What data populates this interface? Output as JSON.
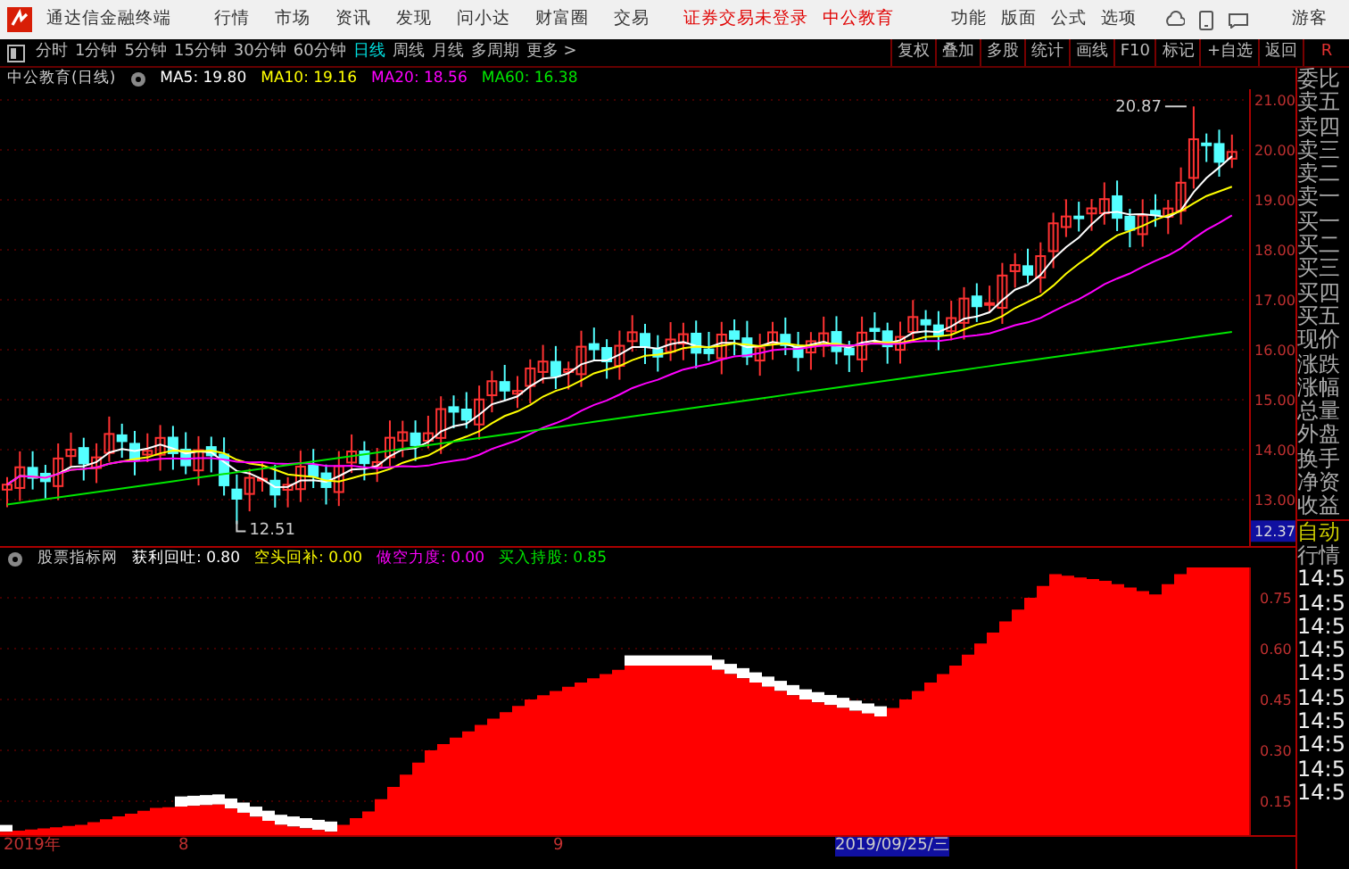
{
  "app": {
    "title": "通达信金融终端",
    "menu": [
      "行情",
      "市场",
      "资讯",
      "发现",
      "问小达",
      "财富圈",
      "交易"
    ],
    "notices": [
      "证券交易未登录",
      "中公教育"
    ],
    "tools": [
      "功能",
      "版面",
      "公式",
      "选项"
    ],
    "user": "游客"
  },
  "periods": [
    {
      "label": "分时",
      "selected": false
    },
    {
      "label": "1分钟",
      "selected": false
    },
    {
      "label": "5分钟",
      "selected": false
    },
    {
      "label": "15分钟",
      "selected": false
    },
    {
      "label": "30分钟",
      "selected": false
    },
    {
      "label": "60分钟",
      "selected": false
    },
    {
      "label": "日线",
      "selected": true
    },
    {
      "label": "周线",
      "selected": false
    },
    {
      "label": "月线",
      "selected": false
    },
    {
      "label": "多周期",
      "selected": false
    },
    {
      "label": "更多 >",
      "selected": false
    }
  ],
  "chart_tools": [
    "复权",
    "叠加",
    "多股",
    "统计",
    "画线",
    "F10",
    "标记",
    "+自选",
    "返回"
  ],
  "corner_label": "R",
  "main_chart": {
    "title": "中公教育(日线)",
    "averages": [
      {
        "label": "MA5: 19.80",
        "color": "#ffffff"
      },
      {
        "label": "MA10: 19.16",
        "color": "#ffff00"
      },
      {
        "label": "MA20: 18.56",
        "color": "#ff00ff"
      },
      {
        "label": "MA60: 16.38",
        "color": "#00e600"
      }
    ],
    "price_axis": [
      "21.00",
      "20.00",
      "19.00",
      "18.00",
      "17.00",
      "16.00",
      "15.00",
      "14.00",
      "13.00"
    ],
    "high_label": "20.87",
    "low_label": "12.51",
    "cursor_price": "12.37"
  },
  "indicator": {
    "title": "股票指标网",
    "values": [
      {
        "label": "获利回吐: 0.80",
        "color": "#ffffff"
      },
      {
        "label": "空头回补: 0.00",
        "color": "#ffff00"
      },
      {
        "label": "做空力度: 0.00",
        "color": "#ff00ff"
      },
      {
        "label": "买入持股: 0.85",
        "color": "#00e600"
      }
    ],
    "axis": [
      "0.75",
      "0.60",
      "0.45",
      "0.30",
      "0.15"
    ]
  },
  "date_axis": [
    {
      "label": "2019年",
      "selected": false
    },
    {
      "label": "8",
      "selected": false
    },
    {
      "label": "9",
      "selected": false
    },
    {
      "label": "2019/09/25/三",
      "selected": true
    }
  ],
  "quote_panel": {
    "labels": [
      "委比",
      "卖五",
      "卖四",
      "卖三",
      "卖二",
      "卖一",
      "买一",
      "买二",
      "买三",
      "买四",
      "买五",
      "现价",
      "涨跌",
      "涨幅",
      "总量",
      "外盘",
      "换手",
      "净资",
      "收益"
    ],
    "mode": "自动",
    "section": "行情",
    "times": [
      "14:5",
      "14:5",
      "14:5",
      "14:5",
      "14:5",
      "14:5",
      "14:5",
      "14:5",
      "14:5",
      "14:5"
    ]
  }
}
